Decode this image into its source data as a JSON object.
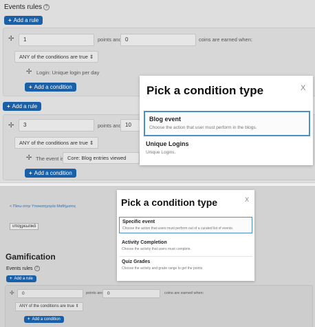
{
  "top": {
    "events_rules": "Events rules",
    "help_icon": "?",
    "add_rule_1": "Add a rule",
    "rule1": {
      "points": "1",
      "points_and": "points and",
      "coins": "0",
      "coins_text": "coins are earned when:",
      "conditions_select": "ANY of the conditions are true",
      "condition_item": "Login: Unique login per day",
      "add_condition": "Add a condition"
    },
    "add_rule_2": "Add a rule",
    "rule2": {
      "points": "3",
      "points_and": "points and",
      "coins": "10",
      "conditions_select": "ANY of the conditions are true",
      "event_label": "The event is",
      "event_value": "Core: Blog entries viewed",
      "add_condition": "Add a condition"
    }
  },
  "modal1": {
    "title": "Pick a condition type",
    "close": "X",
    "options": [
      {
        "title": "Blog event",
        "desc": "Choose the action that user must perform in the blogs."
      },
      {
        "title": "Unique Logins",
        "desc": "Unique Logins."
      }
    ]
  },
  "bottom": {
    "back_link": "< Πίσω στην Υποκατηγορία Μαθήματος",
    "tag": "υποχρεωτικό",
    "title": "Gamification",
    "events_rules": "Events rules",
    "help_icon": "?",
    "add_rule": "Add a rule",
    "rule": {
      "points": "0",
      "points_and": "points and",
      "coins": "0",
      "coins_text": "coins are earned when:",
      "conditions_select": "ANY of the conditions are true",
      "add_condition": "Add a condition"
    }
  },
  "modal2": {
    "title": "Pick a condition type",
    "close": "X",
    "options": [
      {
        "title": "Specific event",
        "desc": "Choose the action that users must perform out of a curated list of events."
      },
      {
        "title": "Activity Completion",
        "desc": "Choose the activity that users must complete."
      },
      {
        "title": "Quiz Grades",
        "desc": "Choose the activity and grade range to get the points"
      }
    ]
  },
  "colors": {
    "primary_button": "#1a60a8",
    "selected_border": "#4a8fc5"
  }
}
